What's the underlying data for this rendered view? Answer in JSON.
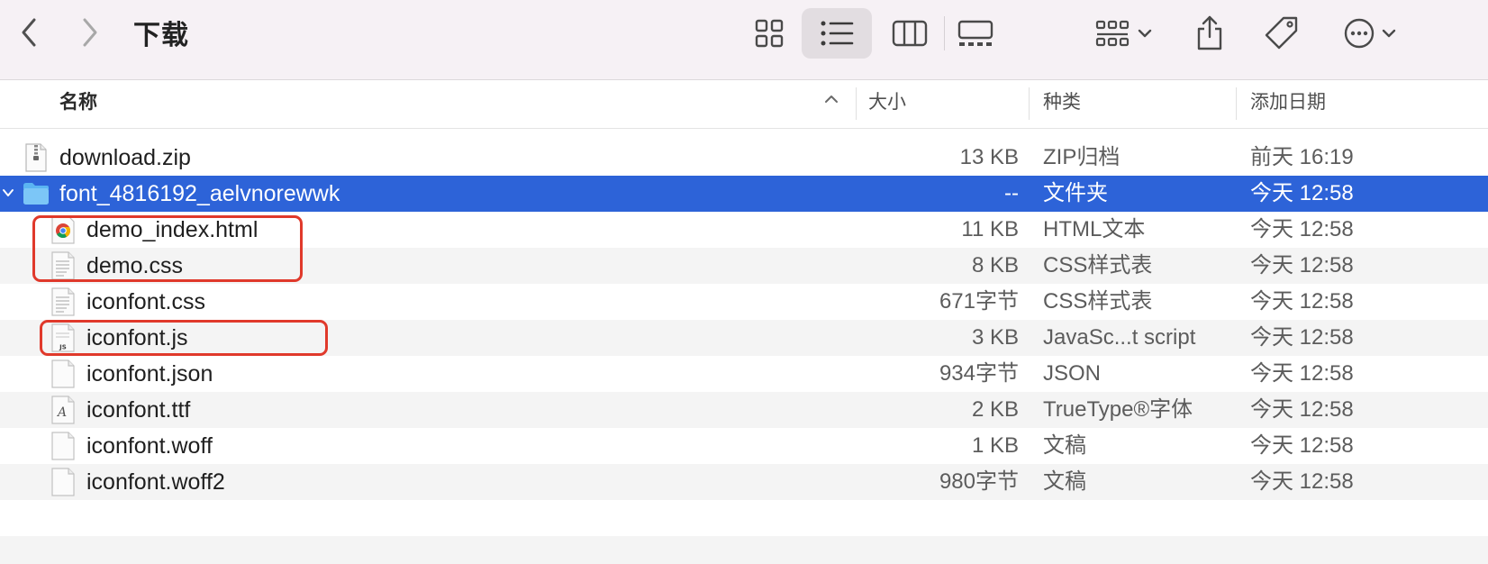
{
  "toolbar": {
    "title": "下载",
    "icons": [
      "back-icon",
      "forward-icon",
      "grid-view-icon",
      "list-view-icon",
      "column-view-icon",
      "gallery-view-icon",
      "group-icon",
      "share-icon",
      "tag-icon",
      "more-icon"
    ],
    "active_view": "list"
  },
  "columns": {
    "name": "名称",
    "size": "大小",
    "kind": "种类",
    "date": "添加日期"
  },
  "files": [
    {
      "name": "download.zip",
      "size": "13 KB",
      "kind": "ZIP归档",
      "date": "前天 16:19",
      "icon": "zip-icon"
    },
    {
      "name": "font_4816192_aelvnorewwk",
      "size": "--",
      "kind": "文件夹",
      "date": "今天 12:58",
      "icon": "folder-icon",
      "selected": true,
      "expanded": true
    },
    {
      "name": "demo_index.html",
      "size": "11 KB",
      "kind": "HTML文本",
      "date": "今天 12:58",
      "icon": "chrome-icon"
    },
    {
      "name": "demo.css",
      "size": "8 KB",
      "kind": "CSS样式表",
      "date": "今天 12:58",
      "icon": "css-file-icon"
    },
    {
      "name": "iconfont.css",
      "size": "671字节",
      "kind": "CSS样式表",
      "date": "今天 12:58",
      "icon": "css-file-icon"
    },
    {
      "name": "iconfont.js",
      "size": "3 KB",
      "kind": "JavaSc...t script",
      "date": "今天 12:58",
      "icon": "js-file-icon"
    },
    {
      "name": "iconfont.json",
      "size": "934字节",
      "kind": "JSON",
      "date": "今天 12:58",
      "icon": "blank-file-icon"
    },
    {
      "name": "iconfont.ttf",
      "size": "2 KB",
      "kind": "TrueType®字体",
      "date": "今天 12:58",
      "icon": "font-file-icon"
    },
    {
      "name": "iconfont.woff",
      "size": "1 KB",
      "kind": "文稿",
      "date": "今天 12:58",
      "icon": "blank-file-icon"
    },
    {
      "name": "iconfont.woff2",
      "size": "980字节",
      "kind": "文稿",
      "date": "今天 12:58",
      "icon": "blank-file-icon"
    }
  ],
  "colors": {
    "selection": "#2d63d8",
    "highlight_box": "#e0392b",
    "toolbar_bg": "#f6f1f5",
    "alt_row": "#f4f4f4"
  }
}
